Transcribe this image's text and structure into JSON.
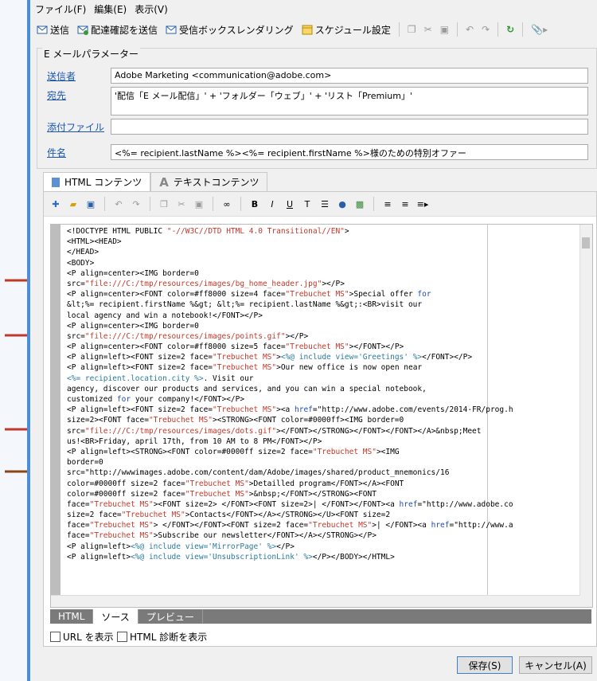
{
  "menu": [
    "ファイル(F)",
    "編集(E)",
    "表示(V)"
  ],
  "toolbar": {
    "send": "送信",
    "send_proof": "配達確認を送信",
    "inbox_rendering": "受信ボックスレンダリング",
    "schedule": "スケジュール設定"
  },
  "params": {
    "legend": "E メールパラメーター",
    "sender_label": "送信者",
    "sender_value": "Adobe Marketing  <communication@adobe.com>",
    "to_label": "宛先",
    "to_value": "'配信「E メール配信」' + 'フォルダー「ウェブ」' + 'リスト「Premium」'",
    "attach_label": "添付ファイル",
    "attach_value": "",
    "subject_label": "件名",
    "subject_value": "<%= recipient.lastName %><%= recipient.firstName %>様のための特別オファー"
  },
  "tabs": [
    "HTML コンテンツ",
    "テキストコンテンツ"
  ],
  "code_lines": [
    "<!DOCTYPE HTML PUBLIC \"-//W3C//DTD HTML 4.0 Transitional//EN\">",
    "<HTML><HEAD>",
    "</HEAD>",
    "<BODY>",
    "<P align=center><IMG border=0",
    "src=\"file:///C:/tmp/resources/images/bg_home_header.jpg\"></P>",
    "<P align=center><FONT color=#ff8000 size=4 face=\"Trebuchet MS\">Special offer for",
    "&lt;%= recipient.firstName %&gt; &lt;%= recipient.lastName %&gt;:<BR>visit our",
    "local agency and win a notebook!</FONT></P>",
    "<P align=center><IMG border=0",
    "src=\"file:///C:/tmp/resources/images/points.gif\"></P>",
    "<P align=center><FONT color=#ff8000 size=5 face=\"Trebuchet MS\"></FONT></P>",
    "<P align=left><FONT size=2 face=\"Trebuchet MS\"><%@ include view='Greetings' %></FONT></P>",
    "<P align=left><FONT size=2 face=\"Trebuchet MS\">Our new office is now open near",
    "<%= recipient.location.city %>. Visit our",
    "agency, discover our products and services, and you can win a special notebook,",
    "customized for your company!</FONT></P>",
    "<P align=left><FONT size=2 face=\"Trebuchet MS\"><a href=\"http://www.adobe.com/events/2014-FR/prog.h",
    "size=2><FONT face=\"Trebuchet MS\"><STRONG><FONT color=#0000ff><IMG border=0",
    "src=\"file:///C:/tmp/resources/images/dots.gif\"></FONT></STRONG></FONT></FONT></A>&nbsp;Meet",
    "us!<BR>Friday, april 17th, from 10 AM to 8 PM</FONT></P>",
    "<P align=left><STRONG><FONT color=#0000ff size=2 face=\"Trebuchet MS\"><IMG",
    "border=0",
    "src=\"http://wwwimages.adobe.com/content/dam/Adobe/images/shared/product_mnemonics/16",
    "color=#0000ff size=2 face=\"Trebuchet MS\">Detailled program</FONT></A><FONT",
    "color=#0000ff size=2 face=\"Trebuchet MS\">&nbsp;</FONT></STRONG><FONT",
    "face=\"Trebuchet MS\"><FONT size=2> </FONT><FONT size=2>| </FONT></FONT><a href=\"http://www.adobe.co",
    "size=2 face=\"Trebuchet MS\">Contacts</FONT></A></STRONG></U><FONT size=2",
    "face=\"Trebuchet MS\"> </FONT></FONT><FONT size=2 face=\"Trebuchet MS\">| </FONT><a href=\"http://www.a",
    "face=\"Trebuchet MS\">Subscribe our newsletter</FONT></A></STRONG></P>",
    "<P align=left><%@ include view='MirrorPage' %></P>",
    "<P align=left><%@ include view='UnsubscriptionLink' %></P></BODY></HTML>"
  ],
  "bottom_tabs": [
    "HTML",
    "ソース",
    "プレビュー"
  ],
  "checkboxes": [
    "URL を表示",
    "HTML 診断を表示"
  ],
  "buttons": {
    "save": "保存(S)",
    "cancel": "キャンセル(A)"
  },
  "colors": {
    "arrow": "#c0392b",
    "link": "#1a56b0",
    "attr_value": "#c0392b"
  }
}
